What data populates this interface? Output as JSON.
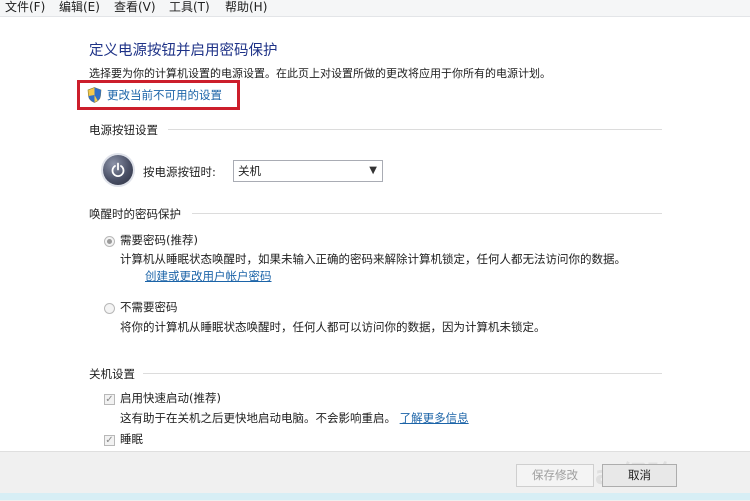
{
  "menu": [
    "文件(F)",
    "编辑(E)",
    "查看(V)",
    "工具(T)",
    "帮助(H)"
  ],
  "page": {
    "title": "定义电源按钮并启用密码保护",
    "description": "选择要为你的计算机设置的电源设置。在此页上对设置所做的更改将应用于你所有的电源计划。",
    "change_link": "更改当前不可用的设置"
  },
  "power_button": {
    "section_title": "电源按钮设置",
    "label": "按电源按钮时:",
    "selected": "关机"
  },
  "wake_password": {
    "section_title": "唤醒时的密码保护",
    "option1_label": "需要密码(推荐)",
    "option1_desc": "计算机从睡眠状态唤醒时，如果未输入正确的密码来解除计算机锁定，任何人都无法访问你的数据。",
    "option1_link": "创建或更改用户帐户密码",
    "option2_label": "不需要密码",
    "option2_desc": "将你的计算机从睡眠状态唤醒时，任何人都可以访问你的数据，因为计算机未锁定。"
  },
  "shutdown": {
    "section_title": "关机设置",
    "fast_startup_label": "启用快速启动(推荐)",
    "fast_startup_desc": "这有助于在关机之后更快地启动电脑。不会影响重启。",
    "learn_more": "了解更多信息",
    "sleep_label": "睡眠"
  },
  "buttons": {
    "save": "保存修改",
    "cancel": "取消"
  },
  "watermark": "Bai经验"
}
